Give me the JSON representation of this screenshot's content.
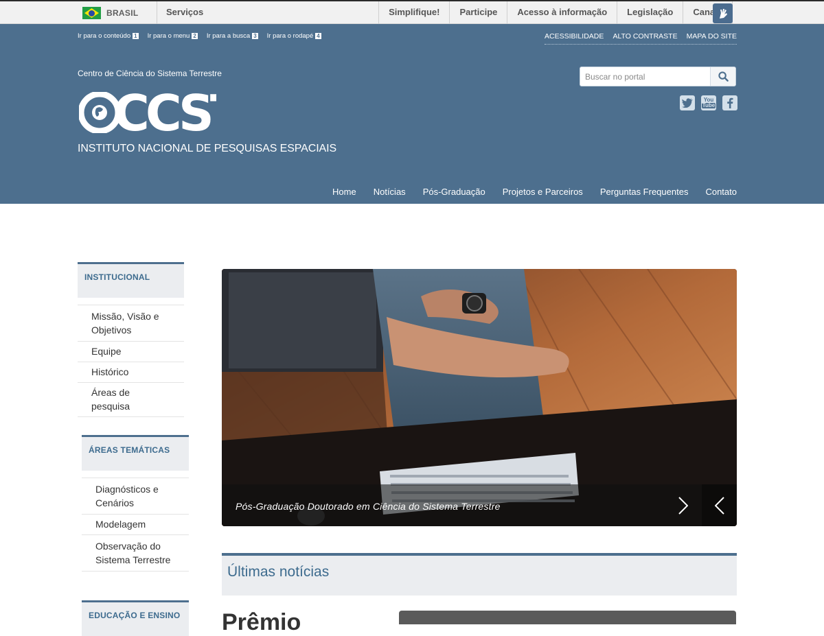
{
  "gov_bar": {
    "brasil": "BRASIL",
    "servicos": "Serviços",
    "links": [
      "Simplifique!",
      "Participe",
      "Acesso à informação",
      "Legislação",
      "Canais"
    ]
  },
  "header": {
    "skip_links": [
      {
        "label": "Ir para o conteúdo",
        "key": "1"
      },
      {
        "label": "Ir para o menu",
        "key": "2"
      },
      {
        "label": "Ir para a busca",
        "key": "3"
      },
      {
        "label": "Ir para o rodapé",
        "key": "4"
      }
    ],
    "accessibility_links": [
      "ACESSIBILIDADE",
      "ALTO CONTRASTE",
      "MAPA DO SITE"
    ],
    "center_name": "Centro de Ciência do Sistema Terrestre",
    "logo_text": "CCST",
    "institute_name": "INSTITUTO NACIONAL DE PESQUISAS ESPACIAIS",
    "search": {
      "placeholder": "Buscar no portal"
    },
    "social": [
      {
        "name": "twitter-icon",
        "glyph": "t"
      },
      {
        "name": "youtube-icon",
        "glyph": "You Tube"
      },
      {
        "name": "facebook-icon",
        "glyph": "f"
      }
    ],
    "nav": [
      "Home",
      "Notícias",
      "Pós-Graduação",
      "Projetos e Parceiros",
      "Perguntas Frequentes",
      "Contato"
    ]
  },
  "sidebar": {
    "institucional": {
      "title": "INSTITUCIONAL",
      "items": [
        "Missão, Visão e Objetivos",
        "Equipe",
        "Histórico",
        "Áreas de pesquisa"
      ]
    },
    "areas": {
      "title": "ÁREAS TEMÁTICAS",
      "items": [
        "Diagnósticos e Cenários",
        "Modelagem",
        "Observação do Sistema Terrestre"
      ]
    },
    "educacao": {
      "title": "EDUCAÇÃO E ENSINO"
    }
  },
  "carousel": {
    "caption": "Pós-Graduação Doutorado em Ciência do Sistema Terrestre"
  },
  "news": {
    "title": "Últimas notícias",
    "first_headline_fragment": "Prêmio"
  },
  "colors": {
    "header_bg": "#4d6f8e",
    "section_title": "#3d6b8e",
    "panel_bg": "#ebedf0"
  }
}
